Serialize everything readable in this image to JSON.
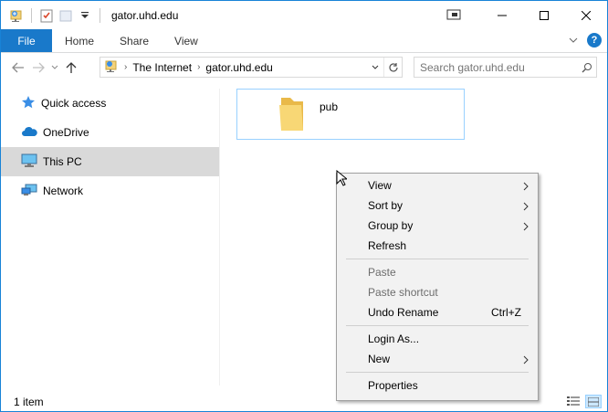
{
  "window": {
    "title": "gator.uhd.edu"
  },
  "ribbon": {
    "tabs": [
      "File",
      "Home",
      "Share",
      "View"
    ]
  },
  "address": {
    "crumbs": [
      "The Internet",
      "gator.uhd.edu"
    ]
  },
  "search": {
    "placeholder": "Search gator.uhd.edu"
  },
  "sidebar": {
    "items": [
      {
        "label": "Quick access",
        "icon": "star-icon"
      },
      {
        "label": "OneDrive",
        "icon": "cloud-icon"
      },
      {
        "label": "This PC",
        "icon": "computer-icon",
        "selected": true
      },
      {
        "label": "Network",
        "icon": "network-icon"
      }
    ]
  },
  "content": {
    "items": [
      {
        "name": "pub",
        "icon": "folder-icon"
      }
    ]
  },
  "status": {
    "count": "1 item"
  },
  "context_menu": {
    "items": [
      {
        "label": "View",
        "submenu": true
      },
      {
        "label": "Sort by",
        "submenu": true
      },
      {
        "label": "Group by",
        "submenu": true
      },
      {
        "label": "Refresh"
      },
      {
        "label": "Paste",
        "disabled": true
      },
      {
        "label": "Paste shortcut",
        "disabled": true
      },
      {
        "label": "Undo Rename",
        "shortcut": "Ctrl+Z"
      },
      {
        "label": "Login As..."
      },
      {
        "label": "New",
        "submenu": true
      },
      {
        "label": "Properties"
      }
    ]
  },
  "colors": {
    "accent": "#1979ca",
    "selection_border": "#99d1ff",
    "selected_bg": "#d9d9d9"
  }
}
